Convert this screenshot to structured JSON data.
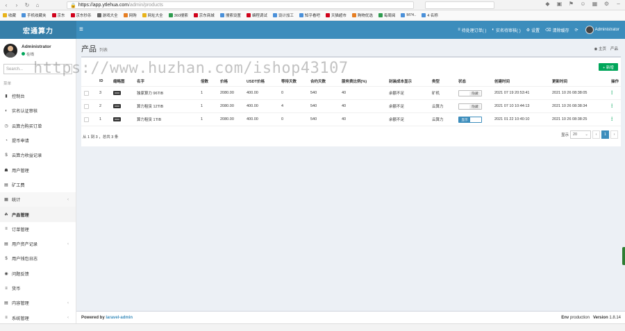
{
  "browser": {
    "url_host": "https://app.ytlehua.com",
    "url_path": "/admin/products",
    "bookmarks": [
      "收藏",
      "手机收藏夹",
      "京东",
      "京东秒杀",
      "游戏大全",
      "网购",
      "网址大全",
      "360搜索",
      "京东商城",
      "搜索设置",
      "编程调试",
      "设计加工",
      "知乎看吧",
      "天猫超市",
      "购物优选",
      "每周阅",
      "M74..",
      "4 名称"
    ]
  },
  "header": {
    "logo": "宏通算力",
    "menu_icon": "≡",
    "actions": [
      {
        "icon": "≡",
        "label": "待处理订单(  )"
      },
      {
        "icon": "◐",
        "label": "实名待审核(  )"
      },
      {
        "icon": "⚙",
        "label": "设置"
      },
      {
        "icon": "⌫",
        "label": "清除缓存"
      },
      {
        "icon": "⟳",
        "label": ""
      }
    ],
    "user": "Administrator"
  },
  "sidebar": {
    "user_name": "Administrator",
    "user_status": "在线",
    "search_placeholder": "Search...",
    "section_label": "菜单",
    "items": [
      {
        "icon": "▮",
        "label": "控制台",
        "chevron": ""
      },
      {
        "icon": "◐",
        "label": "实名认证审核",
        "chevron": ""
      },
      {
        "icon": "◷",
        "label": "云算力购买订单",
        "chevron": ""
      },
      {
        "icon": "◔",
        "label": "提币申请",
        "chevron": ""
      },
      {
        "icon": "$",
        "label": "云算力收益记录",
        "chevron": ""
      },
      {
        "icon": "☗",
        "label": "用户管理",
        "chevron": ""
      },
      {
        "icon": "▤",
        "label": "矿工费",
        "chevron": ""
      },
      {
        "icon": "▦",
        "label": "统计",
        "chevron": "‹"
      },
      {
        "icon": "☘",
        "label": "产品管理",
        "chevron": ""
      },
      {
        "icon": "≡",
        "label": "订单管理",
        "chevron": ""
      },
      {
        "icon": "▤",
        "label": "用户资产记录",
        "chevron": "‹"
      },
      {
        "icon": "$",
        "label": "用户钱包日志",
        "chevron": ""
      },
      {
        "icon": "◉",
        "label": "问题反馈",
        "chevron": ""
      },
      {
        "icon": "≡",
        "label": "货币",
        "chevron": ""
      },
      {
        "icon": "▤",
        "label": "内容管理",
        "chevron": "‹"
      },
      {
        "icon": "≡",
        "label": "系统管理",
        "chevron": "‹"
      }
    ]
  },
  "content": {
    "title": "产品",
    "subtitle": "列表",
    "breadcrumb_home": "主页",
    "breadcrumb_current": "产品",
    "new_button": "+ 新增",
    "columns": [
      "ID",
      "缩略图",
      "名字",
      "倍数",
      "价格",
      "USDT价格",
      "等待天数",
      "合约天数",
      "服务费比例(%)",
      "封装成本显示",
      "类型",
      "状态",
      "创建时间",
      "更新时间",
      "操作"
    ],
    "rows": [
      {
        "id": "3",
        "name": "独家算力 96TIB",
        "multiple": "1",
        "price": "2080.00",
        "usdt": "400.00",
        "wait_days": "0",
        "contract_days": "540",
        "fee": "40",
        "cost": "余额不足",
        "type": "矿机",
        "status": "隐藏",
        "status_on": false,
        "created": "2021 07 19 20:53:41",
        "updated": "2021 10 26 08:38:05",
        "op": "⁞"
      },
      {
        "id": "2",
        "name": "算力租赁 12TIB",
        "multiple": "1",
        "price": "2080.00",
        "usdt": "400.00",
        "wait_days": "4",
        "contract_days": "540",
        "fee": "40",
        "cost": "余额不足",
        "type": "云算力",
        "status": "隐藏",
        "status_on": false,
        "created": "2021 07 10 10:44:13",
        "updated": "2021 10 26 08:38:34",
        "op": "⁞"
      },
      {
        "id": "1",
        "name": "算力租赁 1TIB",
        "multiple": "1",
        "price": "2080.00",
        "usdt": "400.00",
        "wait_days": "0",
        "contract_days": "540",
        "fee": "40",
        "cost": "余额不足",
        "type": "云算力",
        "status": "显示",
        "status_on": true,
        "created": "2021 01 22 10:40:10",
        "updated": "2021 10 26 08:38:25",
        "op": "⁞"
      }
    ],
    "summary": "从 1 到 3 ，总共 3 条",
    "per_page_label": "显示",
    "per_page_value": "20",
    "page_prev": "‹",
    "page_current": "1",
    "page_next": "›"
  },
  "watermark": "https://www.huzhan.com/ishop43107",
  "footer": {
    "powered_by": "Powered by",
    "powered_link": "laravel-admin",
    "env_label": "Env",
    "env_value": "production",
    "version_label": "Version",
    "version_value": "1.8.14"
  }
}
